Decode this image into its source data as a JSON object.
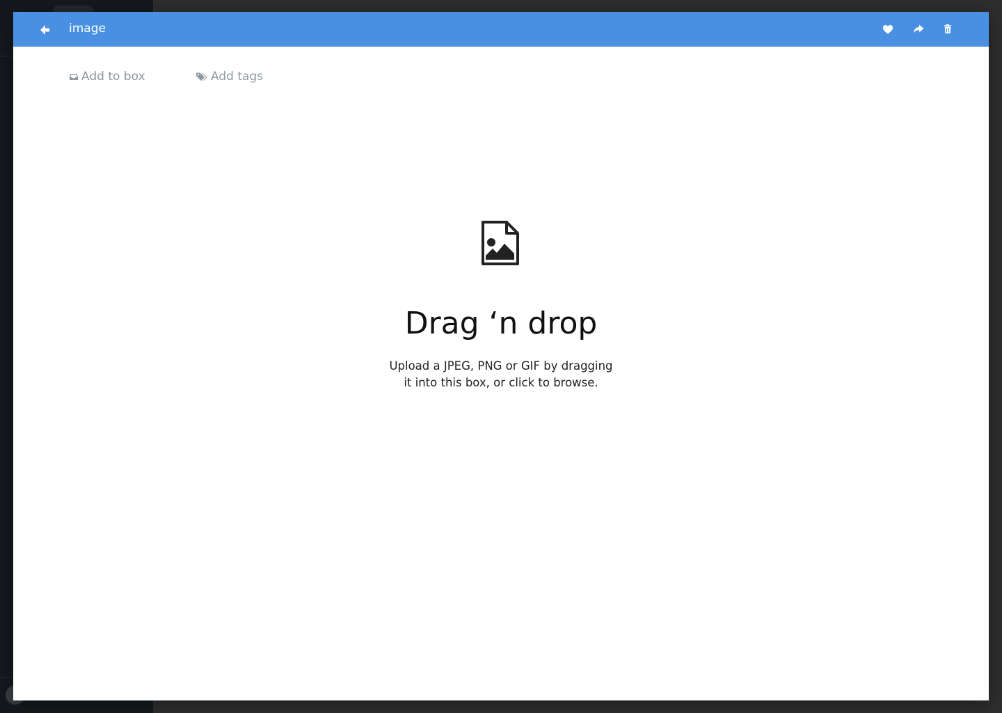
{
  "colors": {
    "header_bg": "#4a90e2",
    "header_text": "#ffffff",
    "meta_text": "#8f97a0",
    "backdrop": "#2e2e2e",
    "sidebar_bg": "#15191d"
  },
  "header": {
    "title": "image",
    "back_icon": "arrow-left-icon",
    "actions": [
      {
        "name": "favorite",
        "icon": "heart-icon"
      },
      {
        "name": "share",
        "icon": "share-arrow-icon"
      },
      {
        "name": "delete",
        "icon": "trash-icon"
      }
    ]
  },
  "meta": {
    "add_to_box_label": "Add to box",
    "add_to_box_icon": "inbox-icon",
    "add_tags_label": "Add tags",
    "add_tags_icon": "tags-icon"
  },
  "dropzone": {
    "icon": "file-image-icon",
    "title": "Drag ‘n drop",
    "description_line1": "Upload a JPEG, PNG or GIF by dragging",
    "description_line2": "it into this box, or click to browse."
  }
}
